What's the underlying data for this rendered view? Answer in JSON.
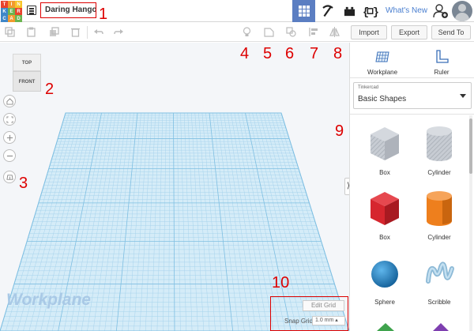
{
  "logo": {
    "cells": [
      {
        "text": "T",
        "color": "#e8432c"
      },
      {
        "text": "I",
        "color": "#f29a2e"
      },
      {
        "text": "N",
        "color": "#f7c52a"
      },
      {
        "text": "K",
        "color": "#3f87c8"
      },
      {
        "text": "E",
        "color": "#6bb54f"
      },
      {
        "text": "R",
        "color": "#e8432c"
      },
      {
        "text": "C",
        "color": "#3f87c8"
      },
      {
        "text": "A",
        "color": "#f29a2e"
      },
      {
        "text": "D",
        "color": "#6bb54f"
      }
    ]
  },
  "header": {
    "design_title": "Daring Hango",
    "whats_new": "What's New"
  },
  "toolbar": {
    "import_label": "Import",
    "export_label": "Export",
    "send_to_label": "Send To"
  },
  "viewcube": {
    "top_label": "TOP",
    "front_label": "FRONT"
  },
  "workspace": {
    "workplane_label": "Workplane",
    "edit_grid_label": "Edit Grid",
    "snap_grid_label": "Snap Grid",
    "snap_grid_value": "1.0 mm ▴"
  },
  "panel": {
    "workplane_tool": "Workplane",
    "ruler_tool": "Ruler",
    "source_category": "Tinkercad",
    "source_name": "Basic Shapes",
    "shapes": [
      {
        "label": "Box",
        "color": "#b7bcc4",
        "kind": "box-hole"
      },
      {
        "label": "Cylinder",
        "color": "#b7bcc4",
        "kind": "cyl-hole"
      },
      {
        "label": "Box",
        "color": "#d6262e",
        "kind": "box"
      },
      {
        "label": "Cylinder",
        "color": "#ee7f1d",
        "kind": "cyl"
      },
      {
        "label": "Sphere",
        "color": "#1d8ad0",
        "kind": "sphere"
      },
      {
        "label": "Scribble",
        "color": "#9ec6df",
        "kind": "scribble"
      }
    ]
  },
  "annotations": [
    "1",
    "2",
    "3",
    "4",
    "5",
    "6",
    "7",
    "8",
    "9",
    "10"
  ],
  "colors": {
    "accent_blue": "#5b7ec2",
    "annotation_red": "#dd0000",
    "grid_line": "#9fd0ea",
    "grid_fill": "#d5ecf8"
  }
}
